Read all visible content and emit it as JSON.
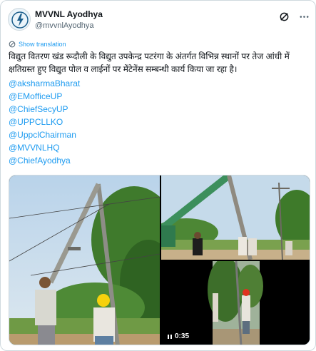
{
  "account": {
    "display_name": "MVVNL Ayodhya",
    "handle": "@mvvnlAyodhya"
  },
  "translate_label": "Show translation",
  "tweet": {
    "text": "विद्युत वितरण खंड रूदौली के विद्युत उपकेन्द्र पटरंगा के अंतर्गत विभिन्न स्थानों पर तेज आंधी में क्षतिग्रस्त हुए विद्युत पोल व लाईनों पर मेंटेनेंस सम्बन्धी कार्य किया जा रहा है।",
    "mentions": [
      "@aksharmaBharat",
      "@EMofficeUP",
      "@ChiefSecyUP",
      "@UPPCLLKO",
      "@UppclChairman",
      "@MVVNLHQ",
      "@ChiefAyodhya"
    ]
  },
  "media": {
    "video_duration": "0:35"
  },
  "icons": {
    "logo": "mvvnl-logo-icon",
    "grok": "grok-icon",
    "more": "more-icon",
    "translate": "globe-icon",
    "play": "play-icon"
  },
  "colors": {
    "link": "#1d9bf0",
    "text": "#0f1419",
    "secondary": "#536471",
    "border": "#cfd9de"
  }
}
